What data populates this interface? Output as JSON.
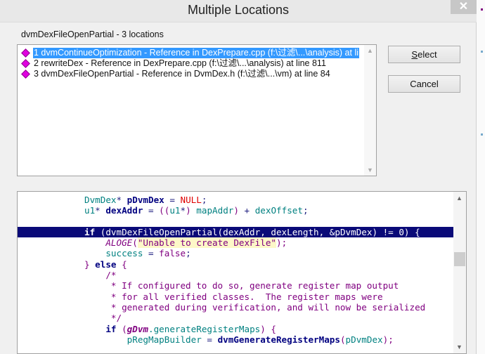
{
  "dialog": {
    "title": "Multiple Locations",
    "close_icon": "close-icon",
    "header_label": "dvmDexFileOpenPartial - 3 locations",
    "locations": [
      {
        "text": "1 dvmContinueOptimization - Reference in DexPrepare.cpp (f:\\过滤\\...\\analysis) at li",
        "selected": true
      },
      {
        "text": "2 rewriteDex - Reference in DexPrepare.cpp (f:\\过滤\\...\\analysis) at line 811",
        "selected": false
      },
      {
        "text": "3 dvmDexFileOpenPartial - Reference in DvmDex.h (f:\\过滤\\...\\vm) at line 84",
        "selected": false
      }
    ],
    "select_label": "Select",
    "select_mnemonic": "S",
    "cancel_label": "Cancel",
    "marker_color": "#e000e0",
    "selection_color": "#3399ff"
  },
  "code": {
    "highlight_color": "#0a0a78",
    "lines": [
      {
        "tokens": [
          [
            "            ",
            "plain"
          ],
          [
            "DvmDex",
            "var"
          ],
          [
            "* ",
            "op"
          ],
          [
            "pDvmDex",
            "id"
          ],
          [
            " = ",
            "op"
          ],
          [
            "NULL",
            "nu"
          ],
          [
            ";",
            "op"
          ]
        ]
      },
      {
        "tokens": [
          [
            "            ",
            "plain"
          ],
          [
            "u1",
            "var"
          ],
          [
            "* ",
            "op"
          ],
          [
            "dexAddr",
            "id"
          ],
          [
            " = ",
            "op"
          ],
          [
            "((",
            "pn"
          ],
          [
            "u1",
            "var"
          ],
          [
            "*",
            "op"
          ],
          [
            ") ",
            "pn"
          ],
          [
            "mapAddr",
            "var"
          ],
          [
            ")",
            "pn"
          ],
          [
            " + ",
            "op"
          ],
          [
            "dexOffset",
            "var"
          ],
          [
            ";",
            "op"
          ]
        ]
      },
      {
        "tokens": [
          [
            "",
            "plain"
          ]
        ]
      },
      {
        "highlight": true,
        "tokens": [
          [
            "            ",
            "plain"
          ],
          [
            "if",
            "kw"
          ],
          [
            " (dvmDexFileOpenPartial(dexAddr, dexLength, &pDvmDex) != 0) {",
            "plain"
          ]
        ]
      },
      {
        "tokens": [
          [
            "                ",
            "plain"
          ],
          [
            "ALOGE",
            "mac"
          ],
          [
            "(",
            "pn"
          ],
          [
            "\"Unable to create DexFile\"",
            "str"
          ],
          [
            ");",
            "pn"
          ]
        ]
      },
      {
        "tokens": [
          [
            "                ",
            "plain"
          ],
          [
            "success",
            "var"
          ],
          [
            " = ",
            "op"
          ],
          [
            "false",
            "pn"
          ],
          [
            ";",
            "op"
          ]
        ]
      },
      {
        "tokens": [
          [
            "            ",
            "plain"
          ],
          [
            "}",
            "pn"
          ],
          [
            " else ",
            "kw"
          ],
          [
            "{",
            "pn"
          ]
        ]
      },
      {
        "tokens": [
          [
            "                ",
            "plain"
          ],
          [
            "/*",
            "cm"
          ]
        ]
      },
      {
        "tokens": [
          [
            "                 ",
            "plain"
          ],
          [
            "* If configured to do so, generate register map output",
            "cm"
          ]
        ]
      },
      {
        "tokens": [
          [
            "                 ",
            "plain"
          ],
          [
            "* for all verified classes.  The register maps were",
            "cm"
          ]
        ]
      },
      {
        "tokens": [
          [
            "                 ",
            "plain"
          ],
          [
            "* generated during verification, and will now be serialized",
            "cm"
          ]
        ]
      },
      {
        "tokens": [
          [
            "                 ",
            "plain"
          ],
          [
            "*/",
            "cm"
          ]
        ]
      },
      {
        "tokens": [
          [
            "                ",
            "plain"
          ],
          [
            "if",
            "kw"
          ],
          [
            " (",
            "pn"
          ],
          [
            "gDvm",
            "gl"
          ],
          [
            ".generateRegisterMaps",
            "mem"
          ],
          [
            ") {",
            "pn"
          ]
        ]
      },
      {
        "tokens": [
          [
            "                    ",
            "plain"
          ],
          [
            "pRegMapBuilder",
            "var"
          ],
          [
            " = ",
            "op"
          ],
          [
            "dvmGenerateRegisterMaps",
            "fn"
          ],
          [
            "(",
            "pn"
          ],
          [
            "pDvmDex",
            "var"
          ],
          [
            ");",
            "pn"
          ]
        ]
      }
    ]
  }
}
